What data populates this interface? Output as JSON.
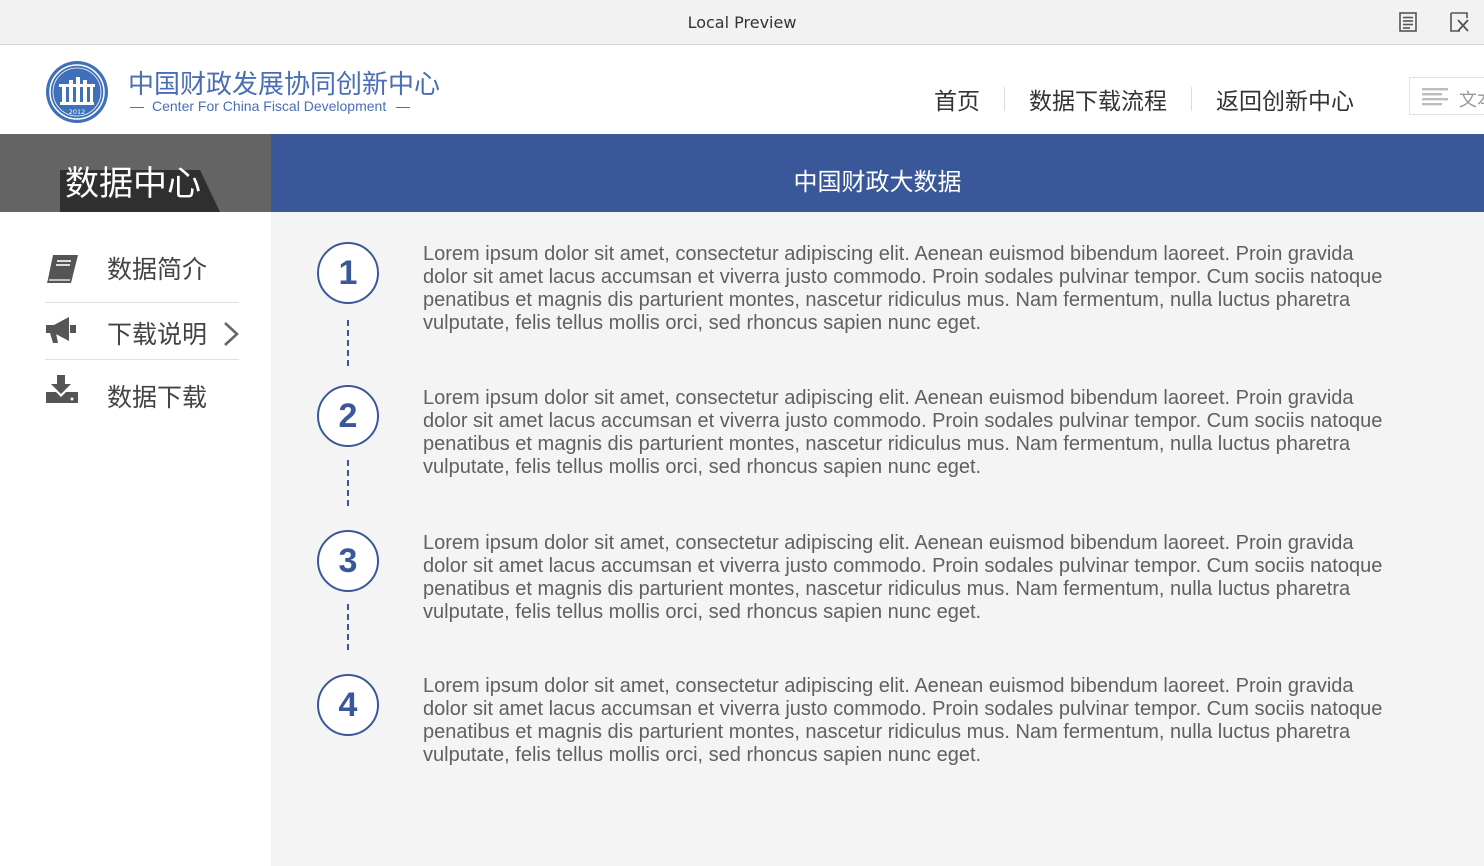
{
  "window": {
    "title": "Local Preview",
    "icons": [
      "reader-mode-icon",
      "close-icon"
    ]
  },
  "header": {
    "logo_icon": "cfdc-emblem-logo",
    "logo_year": "2012",
    "brand_cn": "中国财政发展协同创新中心",
    "brand_en": "Center For China Fiscal Development",
    "nav": [
      {
        "label": "首页"
      },
      {
        "label": "数据下载流程"
      },
      {
        "label": "返回创新中心"
      }
    ],
    "search": {
      "icon": "list-lines-icon",
      "placeholder": "文本"
    }
  },
  "sidebar": {
    "title": "数据中心",
    "items": [
      {
        "label": "数据简介",
        "icon": "book-icon"
      },
      {
        "label": "下载说明",
        "icon": "megaphone-icon",
        "active": true
      },
      {
        "label": "数据下载",
        "icon": "download-tray-icon"
      }
    ]
  },
  "main": {
    "title": "中国财政大数据",
    "accent_color": "#3a5899",
    "steps": [
      {
        "number": "1",
        "text": "Lorem ipsum dolor sit amet, consectetur adipiscing elit. Aenean euismod bibendum laoreet. Proin gravida dolor sit amet lacus accumsan et viverra justo commodo. Proin sodales pulvinar tempor. Cum sociis natoque penatibus et magnis dis parturient montes, nascetur ridiculus mus. Nam fermentum, nulla luctus pharetra vulputate, felis tellus mollis orci, sed rhoncus sapien nunc eget."
      },
      {
        "number": "2",
        "text": "Lorem ipsum dolor sit amet, consectetur adipiscing elit. Aenean euismod bibendum laoreet. Proin gravida dolor sit amet lacus accumsan et viverra justo commodo. Proin sodales pulvinar tempor. Cum sociis natoque penatibus et magnis dis parturient montes, nascetur ridiculus mus. Nam fermentum, nulla luctus pharetra vulputate, felis tellus mollis orci, sed rhoncus sapien nunc eget."
      },
      {
        "number": "3",
        "text": "Lorem ipsum dolor sit amet, consectetur adipiscing elit. Aenean euismod bibendum laoreet. Proin gravida dolor sit amet lacus accumsan et viverra justo commodo. Proin sodales pulvinar tempor. Cum sociis natoque penatibus et magnis dis parturient montes, nascetur ridiculus mus. Nam fermentum, nulla luctus pharetra vulputate, felis tellus mollis orci, sed rhoncus sapien nunc eget."
      },
      {
        "number": "4",
        "text": "Lorem ipsum dolor sit amet, consectetur adipiscing elit. Aenean euismod bibendum laoreet. Proin gravida dolor sit amet lacus accumsan et viverra justo commodo. Proin sodales pulvinar tempor. Cum sociis natoque penatibus et magnis dis parturient montes, nascetur ridiculus mus. Nam fermentum, nulla luctus pharetra vulputate, felis tellus mollis orci, sed rhoncus sapien nunc eget."
      }
    ]
  }
}
